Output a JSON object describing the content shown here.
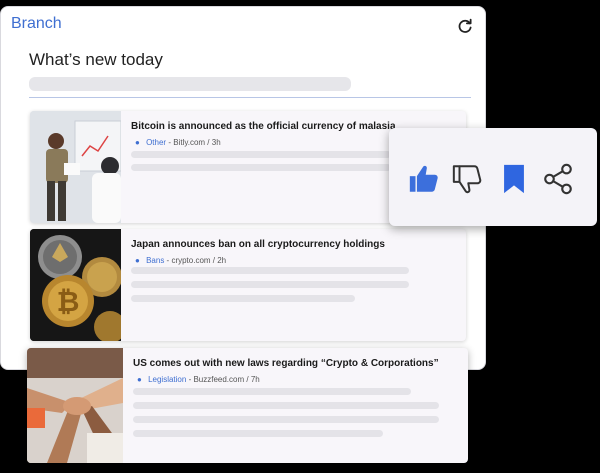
{
  "app": {
    "brand": "Branch"
  },
  "page": {
    "title": "What’s new today"
  },
  "articles": [
    {
      "headline": "Bitcoin is announced as the official currency of malasia",
      "category": "Other",
      "source": "Bitly.com / 3h"
    },
    {
      "headline": "Japan announces ban on all cryptocurrency holdings",
      "category": "Bans",
      "source": "crypto.com / 2h"
    },
    {
      "headline": "US comes out with new laws regarding “Crypto & Corporations”",
      "category": "Legislation",
      "source": "Buzzfeed.com / 7h"
    }
  ],
  "actions": [
    "thumbs-up-icon",
    "thumbs-down-icon",
    "bookmark-icon",
    "share-icon"
  ],
  "colors": {
    "accent": "#3f6fd1",
    "like": "#3c6fdc",
    "bookmark": "#2f66e0"
  }
}
